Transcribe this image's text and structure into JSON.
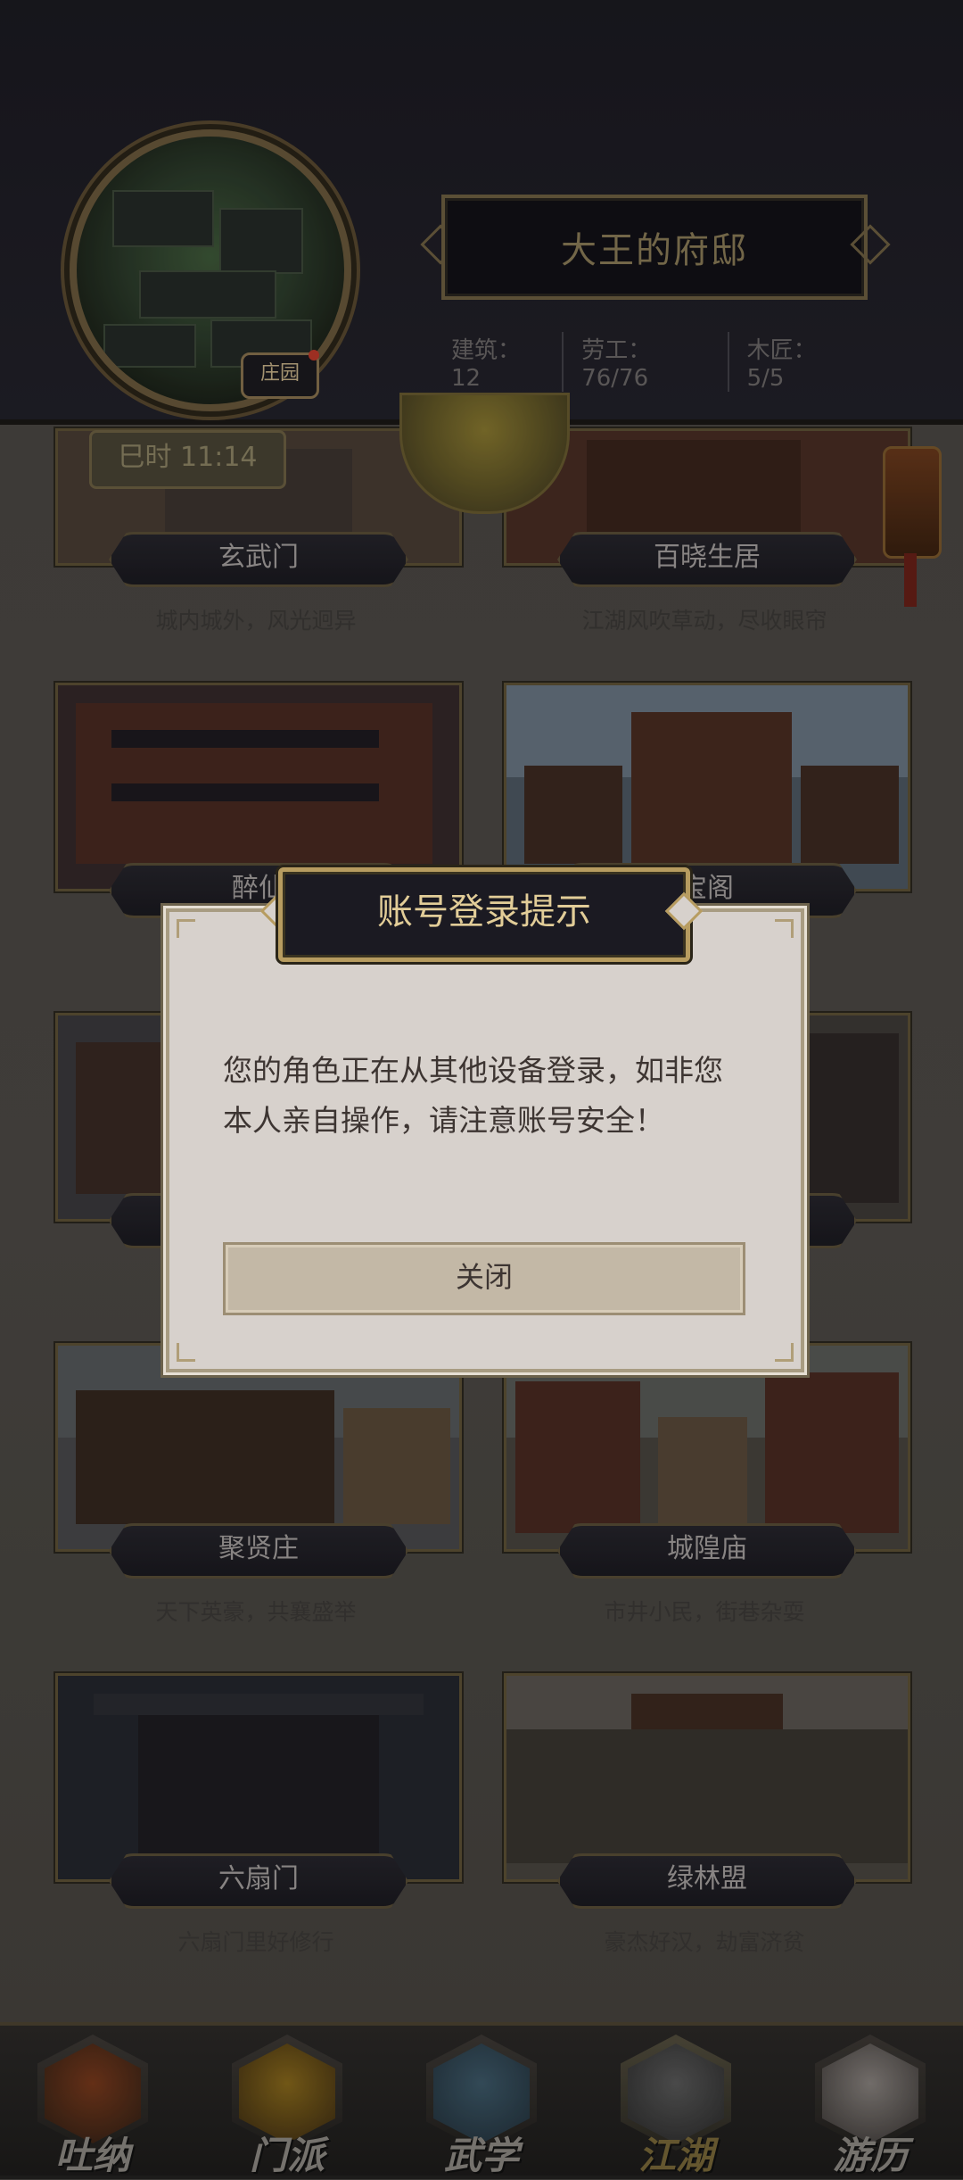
{
  "header": {
    "estate_badge": "庄园",
    "title": "大王的府邸",
    "stats": [
      {
        "label": "建筑",
        "value": "12"
      },
      {
        "label": "劳工",
        "value": "76/76"
      },
      {
        "label": "木匠",
        "value": "5/5"
      }
    ]
  },
  "time": "巳时 11:14",
  "locations": [
    {
      "name": "玄武门",
      "desc": "城内城外，风光迥异"
    },
    {
      "name": "百晓生居",
      "desc": "江湖风吹草动，尽收眼帘"
    },
    {
      "name": "醉仙",
      "desc": ""
    },
    {
      "name": "宝阁",
      "desc": ""
    },
    {
      "name": "",
      "desc": ""
    },
    {
      "name": "",
      "desc": ""
    },
    {
      "name": "聚贤庄",
      "desc": "天下英豪，共襄盛举"
    },
    {
      "name": "城隍庙",
      "desc": "市井小民，街巷杂耍"
    },
    {
      "name": "六扇门",
      "desc": "六扇门里好修行"
    },
    {
      "name": "绿林盟",
      "desc": "豪杰好汉，劫富济贫"
    }
  ],
  "bottom_nav": [
    {
      "label": "吐纳",
      "active": false
    },
    {
      "label": "门派",
      "active": false
    },
    {
      "label": "武学",
      "active": false
    },
    {
      "label": "江湖",
      "active": true
    },
    {
      "label": "游历",
      "active": false
    }
  ],
  "modal": {
    "title": "账号登录提示",
    "message": "您的角色正在从其他设备登录，如非您本人亲自操作，请注意账号安全！",
    "close_label": "关闭"
  },
  "colors": {
    "accent_gold": "#b79c60",
    "modal_bg": "#d7d1cc",
    "header_bg": "#1c1b22"
  }
}
